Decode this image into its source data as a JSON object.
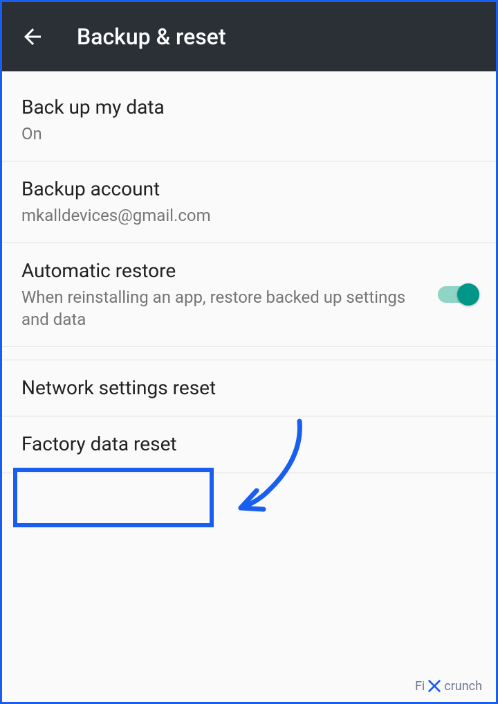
{
  "header": {
    "title": "Backup & reset"
  },
  "items": [
    {
      "title": "Back up my data",
      "subtitle": "On"
    },
    {
      "title": "Backup account",
      "subtitle": "mkalldevices@gmail.com"
    },
    {
      "title": "Automatic restore",
      "subtitle": "When reinstalling an app, restore backed up settings and data",
      "toggle": true
    },
    {
      "title": "Network settings reset"
    },
    {
      "title": "Factory data reset"
    }
  ],
  "watermark": {
    "prefix": "Fi",
    "suffix": "crunch"
  }
}
